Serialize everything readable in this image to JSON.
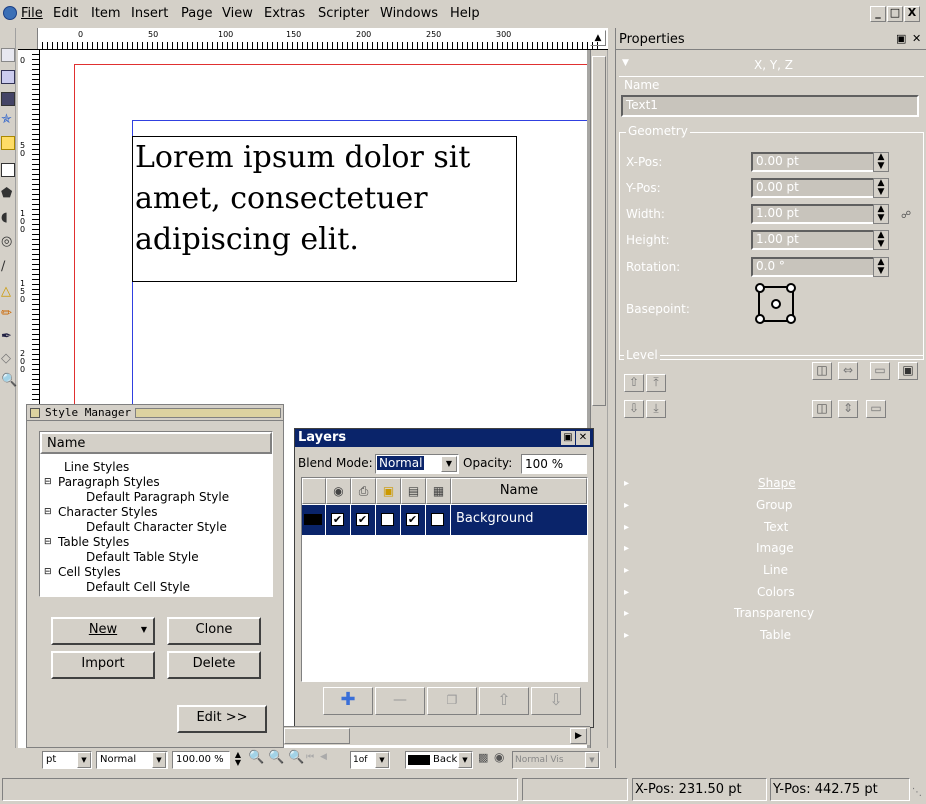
{
  "menubar": {
    "items": [
      "File",
      "Edit",
      "Item",
      "Insert",
      "Page",
      "View",
      "Extras",
      "Scripter",
      "Windows",
      "Help"
    ],
    "window_controls": [
      "_",
      "□",
      "X"
    ]
  },
  "ruler": {
    "h_ticks": [
      "0",
      "50",
      "100",
      "150",
      "200",
      "250",
      "300"
    ],
    "v_ticks": [
      "0",
      "50",
      "100",
      "150",
      "200"
    ]
  },
  "canvas": {
    "text_frame": "Lorem ipsum dolor sit amet, consectetuer adipiscing elit."
  },
  "properties": {
    "title": "Properties",
    "xyz_label": "X, Y, Z",
    "name_group": "Name",
    "name_value": "Text1",
    "geometry_group": "Geometry",
    "xpos_label": "X-Pos:",
    "xpos_value": "0.00 pt",
    "ypos_label": "Y-Pos:",
    "ypos_value": "0.00 pt",
    "width_label": "Width:",
    "width_value": "1.00 pt",
    "height_label": "Height:",
    "height_value": "1.00 pt",
    "rotation_label": "Rotation:",
    "rotation_value": "0.0 °",
    "basepoint_label": "Basepoint:",
    "level_group": "Level",
    "sections": [
      "Shape",
      "Group",
      "Text",
      "Image",
      "Line",
      "Colors",
      "Transparency",
      "Table"
    ]
  },
  "style_manager": {
    "title": "Style Manager",
    "column": "Name",
    "tree": [
      {
        "label": "Line Styles",
        "depth": 0
      },
      {
        "label": "Paragraph Styles",
        "depth": 0
      },
      {
        "label": "Default Paragraph Style",
        "depth": 1
      },
      {
        "label": "Character Styles",
        "depth": 0
      },
      {
        "label": "Default Character Style",
        "depth": 1
      },
      {
        "label": "Table Styles",
        "depth": 0
      },
      {
        "label": "Default Table Style",
        "depth": 1
      },
      {
        "label": "Cell Styles",
        "depth": 0
      },
      {
        "label": "Default Cell Style",
        "depth": 1
      }
    ],
    "new_label": "New",
    "clone_label": "Clone",
    "import_label": "Import",
    "delete_label": "Delete",
    "edit_label": "Edit >>"
  },
  "layers": {
    "title": "Layers",
    "blend_label": "Blend Mode:",
    "blend_value": "Normal",
    "opacity_label": "Opacity:",
    "opacity_value": "100 %",
    "name_header": "Name",
    "layer_name": "Background"
  },
  "bottombar": {
    "unit": "pt",
    "mode": "Normal",
    "zoom": "100.00 %",
    "page": "1of",
    "layer": "Back",
    "vision": "Normal Vis"
  },
  "status": {
    "xpos_label": "X-Pos:",
    "xpos_value": "231.50 pt",
    "ypos_label": "Y-Pos:",
    "ypos_value": "442.75 pt"
  }
}
